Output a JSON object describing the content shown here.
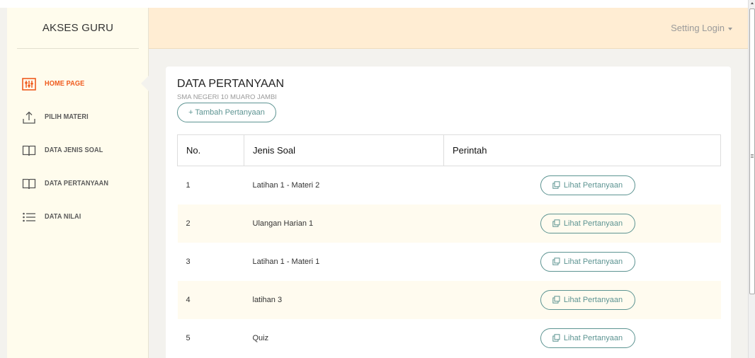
{
  "sidebar": {
    "brand": "AKSES GURU",
    "items": [
      {
        "label": "HOME PAGE",
        "icon": "tools-icon",
        "active": true
      },
      {
        "label": "PILIH MATERI",
        "icon": "upload-icon",
        "active": false
      },
      {
        "label": "DATA JENIS SOAL",
        "icon": "book-icon",
        "active": false
      },
      {
        "label": "DATA PERTANYAAN",
        "icon": "book-icon",
        "active": false
      },
      {
        "label": "DATA NILAI",
        "icon": "list-icon",
        "active": false
      }
    ]
  },
  "topbar": {
    "setting_label": "Setting Login"
  },
  "main": {
    "title": "DATA PERTANYAAN",
    "subtitle": "SMA NEGERI 10 MUARO JAMBI",
    "add_button": "+ Tambah Pertanyaan",
    "table": {
      "headers": [
        "No.",
        "Jenis Soal",
        "Perintah"
      ],
      "rows": [
        {
          "no": "1",
          "jenis": "Latihan 1 - Materi 2",
          "action": "Lihat Pertanyaan"
        },
        {
          "no": "2",
          "jenis": "Ulangan Harian 1",
          "action": "Lihat Pertanyaan"
        },
        {
          "no": "3",
          "jenis": "Latihan 1 - Materi 1",
          "action": "Lihat Pertanyaan"
        },
        {
          "no": "4",
          "jenis": "latihan 3",
          "action": "Lihat Pertanyaan"
        },
        {
          "no": "5",
          "jenis": "Quiz",
          "action": "Lihat Pertanyaan"
        }
      ]
    }
  },
  "colors": {
    "accent": "#ef5b1e",
    "button": "#5d9492",
    "topbar": "#ffedd3",
    "sidebar": "#fffced"
  }
}
